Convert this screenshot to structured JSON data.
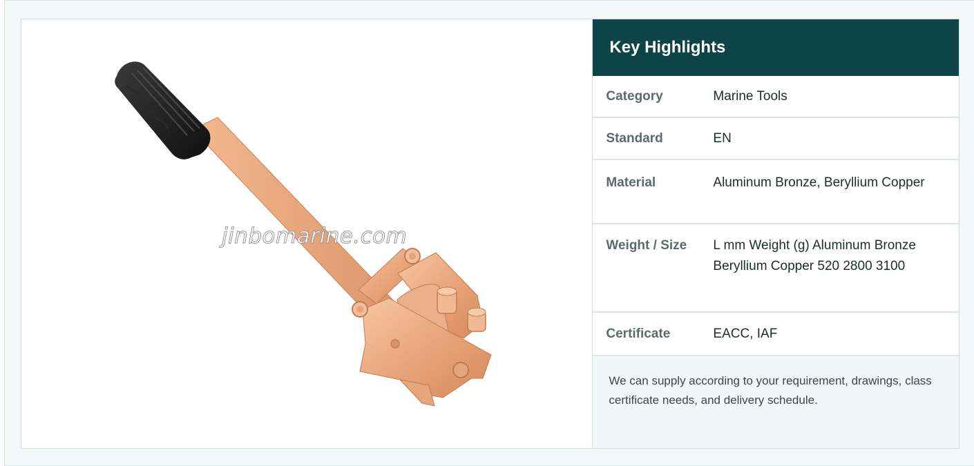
{
  "product": {
    "image_alt": "Marine tool with rubber grip handle",
    "watermark": "jinbomarine.com"
  },
  "highlights": {
    "title": "Key Highlights",
    "rows": [
      {
        "key": "Category",
        "value": "Marine Tools"
      },
      {
        "key": "Standard",
        "value": "EN"
      },
      {
        "key": "Material",
        "value": "Aluminum Bronze, Beryllium Copper"
      },
      {
        "key": "Weight / Size",
        "value": "L mm Weight (g) Aluminum Bronze Beryllium Copper 520 2800 3100"
      },
      {
        "key": "Certificate",
        "value": "EACC, IAF"
      }
    ],
    "note": "We can supply according to your requirement, drawings, class certificate needs, and delivery schedule."
  },
  "colors": {
    "header_bg": "#0e4448",
    "bronze": "#e8a77c",
    "grip": "#1c1c1c"
  }
}
